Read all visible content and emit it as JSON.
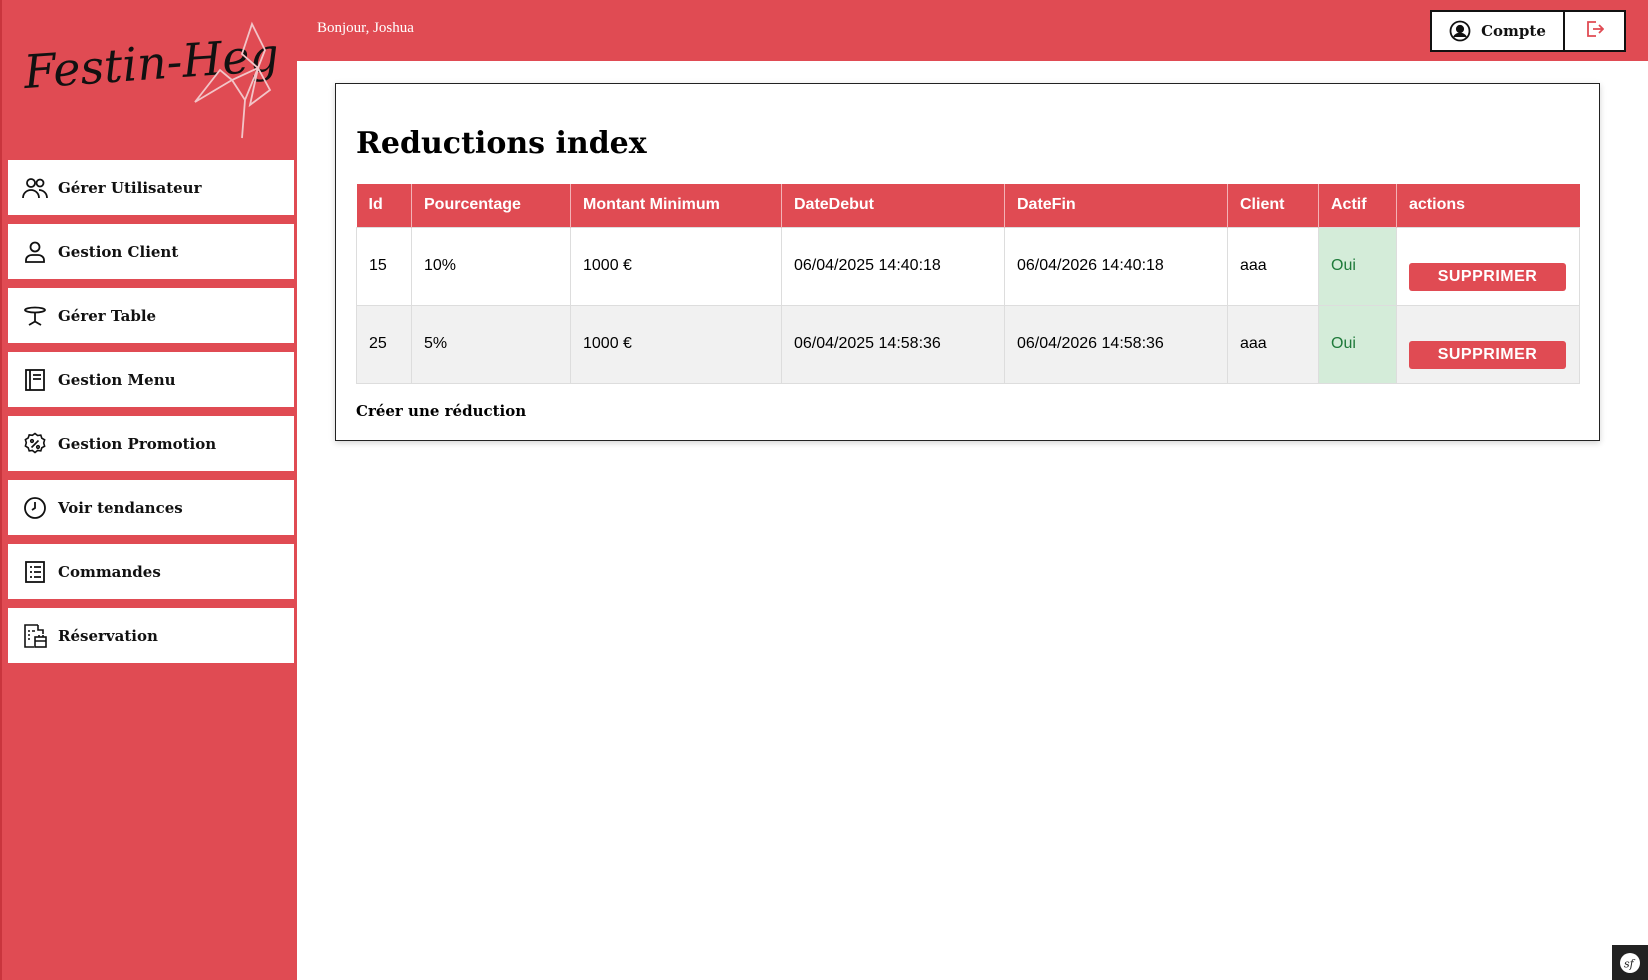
{
  "app": {
    "brand_text": "Festin-Hegre",
    "accent_color": "#e04b53"
  },
  "header": {
    "greeting": "Bonjour, Joshua",
    "account_label": "Compte",
    "account_icon": "user-circle-icon",
    "logout_icon": "logout-icon"
  },
  "sidebar": {
    "items": [
      {
        "label": "Gérer Utilisateur",
        "icon": "users-icon"
      },
      {
        "label": "Gestion Client",
        "icon": "user-icon"
      },
      {
        "label": "Gérer Table",
        "icon": "table-icon"
      },
      {
        "label": "Gestion Menu",
        "icon": "menu-book-icon"
      },
      {
        "label": "Gestion Promotion",
        "icon": "percent-badge-icon"
      },
      {
        "label": "Voir tendances",
        "icon": "clock-icon"
      },
      {
        "label": "Commandes",
        "icon": "list-icon"
      },
      {
        "label": "Réservation",
        "icon": "reservation-icon"
      }
    ]
  },
  "main": {
    "title": "Reductions index",
    "table": {
      "headers": [
        "Id",
        "Pourcentage",
        "Montant Minimum",
        "DateDebut",
        "DateFin",
        "Client",
        "Actif",
        "actions"
      ],
      "rows": [
        {
          "id": "15",
          "pourcentage": "10%",
          "montant": "1000 €",
          "debut": "06/04/2025 14:40:18",
          "fin": "06/04/2026 14:40:18",
          "client": "aaa",
          "actif": "Oui",
          "action": "SUPPRIMER"
        },
        {
          "id": "25",
          "pourcentage": "5%",
          "montant": "1000 €",
          "debut": "06/04/2025 14:58:36",
          "fin": "06/04/2026 14:58:36",
          "client": "aaa",
          "actif": "Oui",
          "action": "SUPPRIMER"
        }
      ]
    },
    "create_link": "Créer une réduction"
  },
  "footer": {
    "badge_icon": "symfony-icon",
    "badge_text": "sf"
  }
}
